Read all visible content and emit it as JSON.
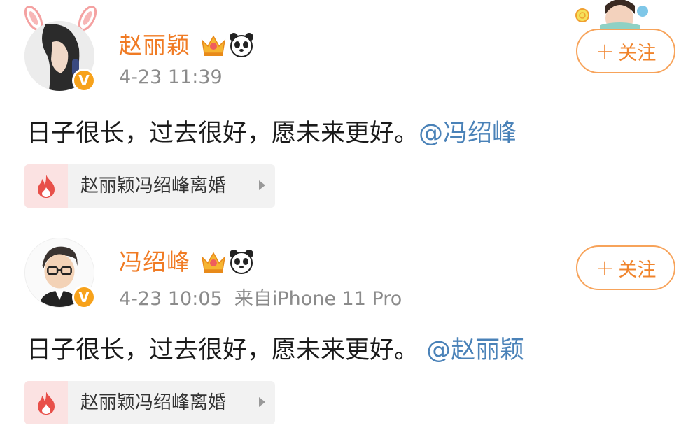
{
  "posts": [
    {
      "username": "赵丽颖",
      "meta": "4-23 11:39",
      "follow_label": "关注",
      "follow_plus": "+",
      "verified_badge": "V",
      "text": "日子很长，过去很好，愿未来更好。",
      "mention": "@冯绍峰",
      "topic": "赵丽颖冯绍峰离婚",
      "icons": [
        "crown-icon",
        "panda-icon",
        "fire-icon",
        "bunny-ears-icon"
      ]
    },
    {
      "username": "冯绍峰",
      "meta": "4-23 10:05  来自iPhone 11 Pro",
      "follow_label": "关注",
      "follow_plus": "+",
      "verified_badge": "V",
      "text": "日子很长，过去很好，愿未来更好。",
      "mention": " @赵丽颖",
      "topic": "赵丽颖冯绍峰离婚",
      "icons": [
        "crown-icon",
        "panda-icon",
        "fire-icon"
      ]
    }
  ],
  "colors": {
    "username": "#f07b24",
    "mention": "#4a82b8",
    "follow_border": "#f7a35a",
    "badge": "#f7a21b",
    "topic_bg": "#f2f2f2",
    "fire": "#e8504a"
  }
}
